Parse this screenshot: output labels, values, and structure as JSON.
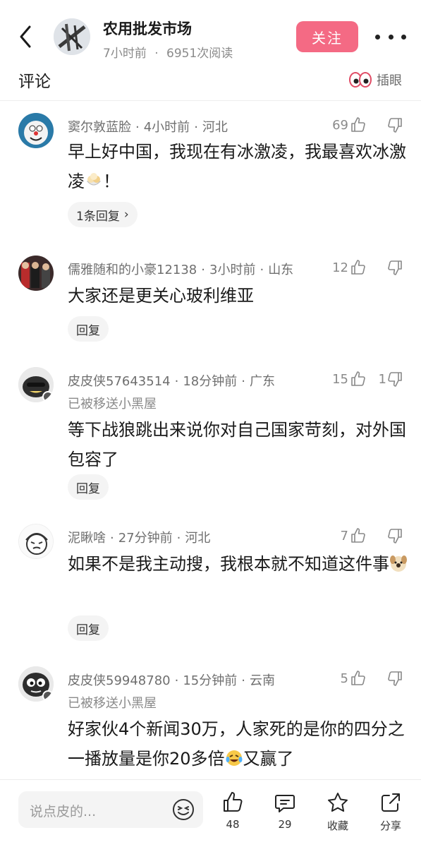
{
  "header": {
    "publisher_name": "农用批发市场",
    "time_ago": "7小时前",
    "reads": "6951次阅读",
    "meta_sep": "·",
    "follow_label": "关注"
  },
  "comments_section": {
    "title": "评论",
    "insert_eye_label": "插眼"
  },
  "comments": [
    {
      "username": "窦尔敦蓝脸",
      "time": "4小时前",
      "location": "河北",
      "likes": "69",
      "dislikes": "",
      "status": "",
      "text": "早上好中国，我现在有冰激凌，我最喜欢冰激凌",
      "text_tail": "！",
      "reply_label": "1条回复",
      "reply_chevron": "›"
    },
    {
      "username": "儒雅随和的小豪12138",
      "time": "3小时前",
      "location": "山东",
      "likes": "12",
      "dislikes": "",
      "status": "",
      "text": "大家还是更关心玻利维亚",
      "text_tail": "",
      "reply_label": "回复"
    },
    {
      "username": "皮皮侠57643514",
      "time": "18分钟前",
      "location": "广东",
      "likes": "15",
      "dislikes": "1",
      "status": "已被移送小黑屋",
      "text": "等下战狼跳出来说你对自己国家苛刻，对外国包容了",
      "text_tail": "",
      "reply_label": "回复"
    },
    {
      "username": "泥瞅啥",
      "time": "27分钟前",
      "location": "河北",
      "likes": "7",
      "dislikes": "",
      "status": "",
      "text": "如果不是我主动搜，我根本就不知道这件事",
      "text_tail": "",
      "reply_label": "回复"
    },
    {
      "username": "皮皮侠59948780",
      "time": "15分钟前",
      "location": "云南",
      "likes": "5",
      "dislikes": "",
      "status": "已被移送小黑屋",
      "text": "好家伙4个新闻30万，人家死的是你的四分之一播放量是你20多倍",
      "text_tail": "又赢了",
      "reply_label": ""
    }
  ],
  "bottom_bar": {
    "input_placeholder": "说点皮的...",
    "like_count": "48",
    "comment_count": "29",
    "favorite_label": "收藏",
    "share_label": "分享"
  },
  "colors": {
    "follow_button": "#f46a84",
    "muted_text": "#8a8a8a"
  }
}
